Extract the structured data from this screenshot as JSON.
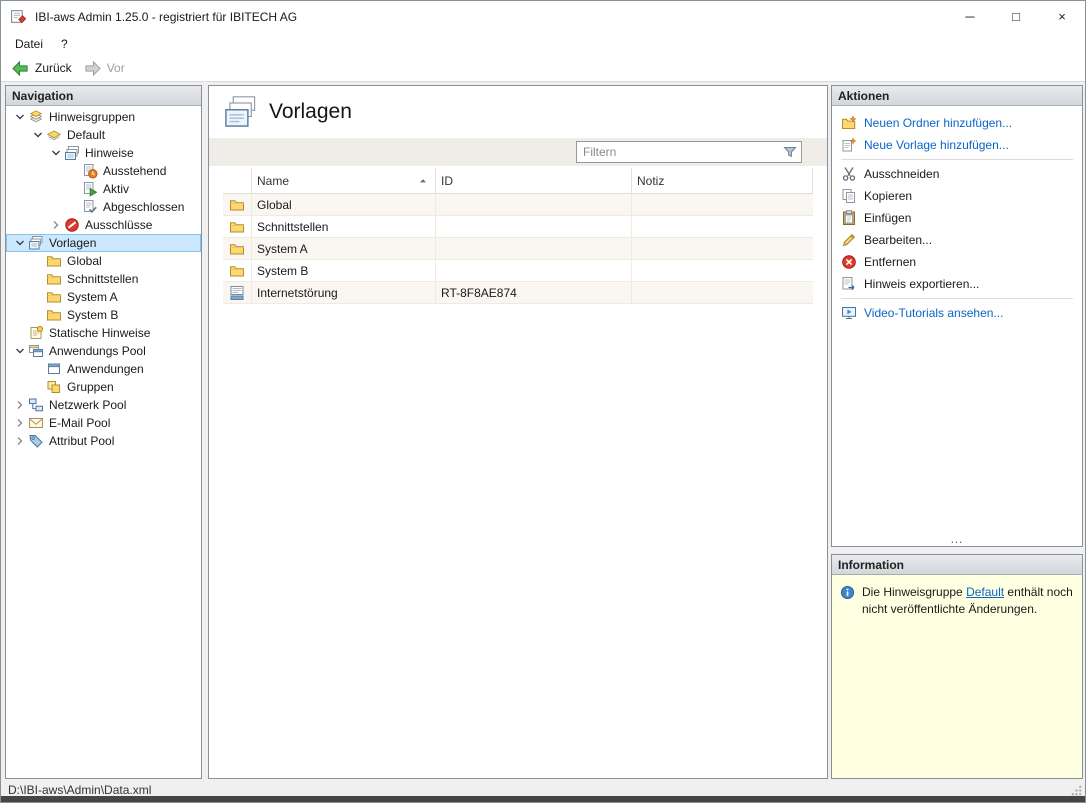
{
  "colors": {
    "link_blue": "#0a64c8",
    "tree_selection": "#cce8ff",
    "info_background": "#ffffe1"
  },
  "window": {
    "title": "IBI-aws Admin 1.25.0 - registriert für IBITECH AG",
    "controls": {
      "minimize": "─",
      "maximize": "□",
      "close": "×"
    },
    "status_path": "D:\\IBI-aws\\Admin\\Data.xml"
  },
  "menu": {
    "items": [
      {
        "label": "Datei"
      },
      {
        "label": "?"
      }
    ]
  },
  "toolbar": {
    "back_label": "Zurück",
    "forward_label": "Vor"
  },
  "navigation": {
    "header": "Navigation",
    "tree": [
      {
        "label": "Hinweisgruppen",
        "depth": 0,
        "chevron": "down",
        "icon": "group"
      },
      {
        "label": "Default",
        "depth": 1,
        "chevron": "down",
        "icon": "default-group"
      },
      {
        "label": "Hinweise",
        "depth": 2,
        "chevron": "down",
        "icon": "hints"
      },
      {
        "label": "Ausstehend",
        "depth": 3,
        "chevron": "none",
        "icon": "pending"
      },
      {
        "label": "Aktiv",
        "depth": 3,
        "chevron": "none",
        "icon": "active"
      },
      {
        "label": "Abgeschlossen",
        "depth": 3,
        "chevron": "none",
        "icon": "done"
      },
      {
        "label": "Ausschlüsse",
        "depth": 2,
        "chevron": "right",
        "icon": "exclusions"
      },
      {
        "label": "Vorlagen",
        "depth": 0,
        "chevron": "down",
        "icon": "templates",
        "selected": true
      },
      {
        "label": "Global",
        "depth": 1,
        "chevron": "none",
        "icon": "folder"
      },
      {
        "label": "Schnittstellen",
        "depth": 1,
        "chevron": "none",
        "icon": "folder"
      },
      {
        "label": "System A",
        "depth": 1,
        "chevron": "none",
        "icon": "folder"
      },
      {
        "label": "System B",
        "depth": 1,
        "chevron": "none",
        "icon": "folder"
      },
      {
        "label": "Statische Hinweise",
        "depth": 0,
        "chevron": "none",
        "icon": "static-hints"
      },
      {
        "label": "Anwendungs Pool",
        "depth": 0,
        "chevron": "down",
        "icon": "app-pool"
      },
      {
        "label": "Anwendungen",
        "depth": 1,
        "chevron": "none",
        "icon": "applications"
      },
      {
        "label": "Gruppen",
        "depth": 1,
        "chevron": "none",
        "icon": "groups"
      },
      {
        "label": "Netzwerk Pool",
        "depth": 0,
        "chevron": "right",
        "icon": "network-pool"
      },
      {
        "label": "E-Mail Pool",
        "depth": 0,
        "chevron": "right",
        "icon": "email-pool"
      },
      {
        "label": "Attribut Pool",
        "depth": 0,
        "chevron": "right",
        "icon": "attribute-pool"
      }
    ]
  },
  "main": {
    "title": "Vorlagen",
    "filter_placeholder": "Filtern",
    "table": {
      "columns": [
        "Name",
        "ID",
        "Notiz"
      ],
      "sorted_by": "Name",
      "sort_direction": "asc",
      "rows": [
        {
          "icon": "folder",
          "name": "Global",
          "id": "",
          "notiz": ""
        },
        {
          "icon": "folder",
          "name": "Schnittstellen",
          "id": "",
          "notiz": ""
        },
        {
          "icon": "folder",
          "name": "System A",
          "id": "",
          "notiz": ""
        },
        {
          "icon": "folder",
          "name": "System B",
          "id": "",
          "notiz": ""
        },
        {
          "icon": "template",
          "name": "Internetstörung",
          "id": "RT-8F8AE874",
          "notiz": ""
        }
      ]
    }
  },
  "actions": {
    "header": "Aktionen",
    "more_label": "…",
    "items": [
      {
        "label": "Neuen Ordner hinzufügen...",
        "style": "link",
        "icon": "new-folder"
      },
      {
        "label": "Neue Vorlage hinzufügen...",
        "style": "link",
        "icon": "new-template"
      },
      {
        "type": "separator"
      },
      {
        "label": "Ausschneiden",
        "style": "normal",
        "icon": "cut"
      },
      {
        "label": "Kopieren",
        "style": "normal",
        "icon": "copy"
      },
      {
        "label": "Einfügen",
        "style": "normal",
        "icon": "paste"
      },
      {
        "label": "Bearbeiten...",
        "style": "normal",
        "icon": "edit"
      },
      {
        "label": "Entfernen",
        "style": "normal",
        "icon": "delete"
      },
      {
        "label": "Hinweis exportieren...",
        "style": "normal",
        "icon": "export-hint"
      },
      {
        "type": "separator"
      },
      {
        "label": "Video-Tutorials ansehen...",
        "style": "link",
        "icon": "video"
      }
    ]
  },
  "information": {
    "header": "Information",
    "text_before": "Die Hinweisgruppe ",
    "link_label": "Default",
    "text_after": " enthält noch nicht veröffentlichte Änderungen."
  }
}
